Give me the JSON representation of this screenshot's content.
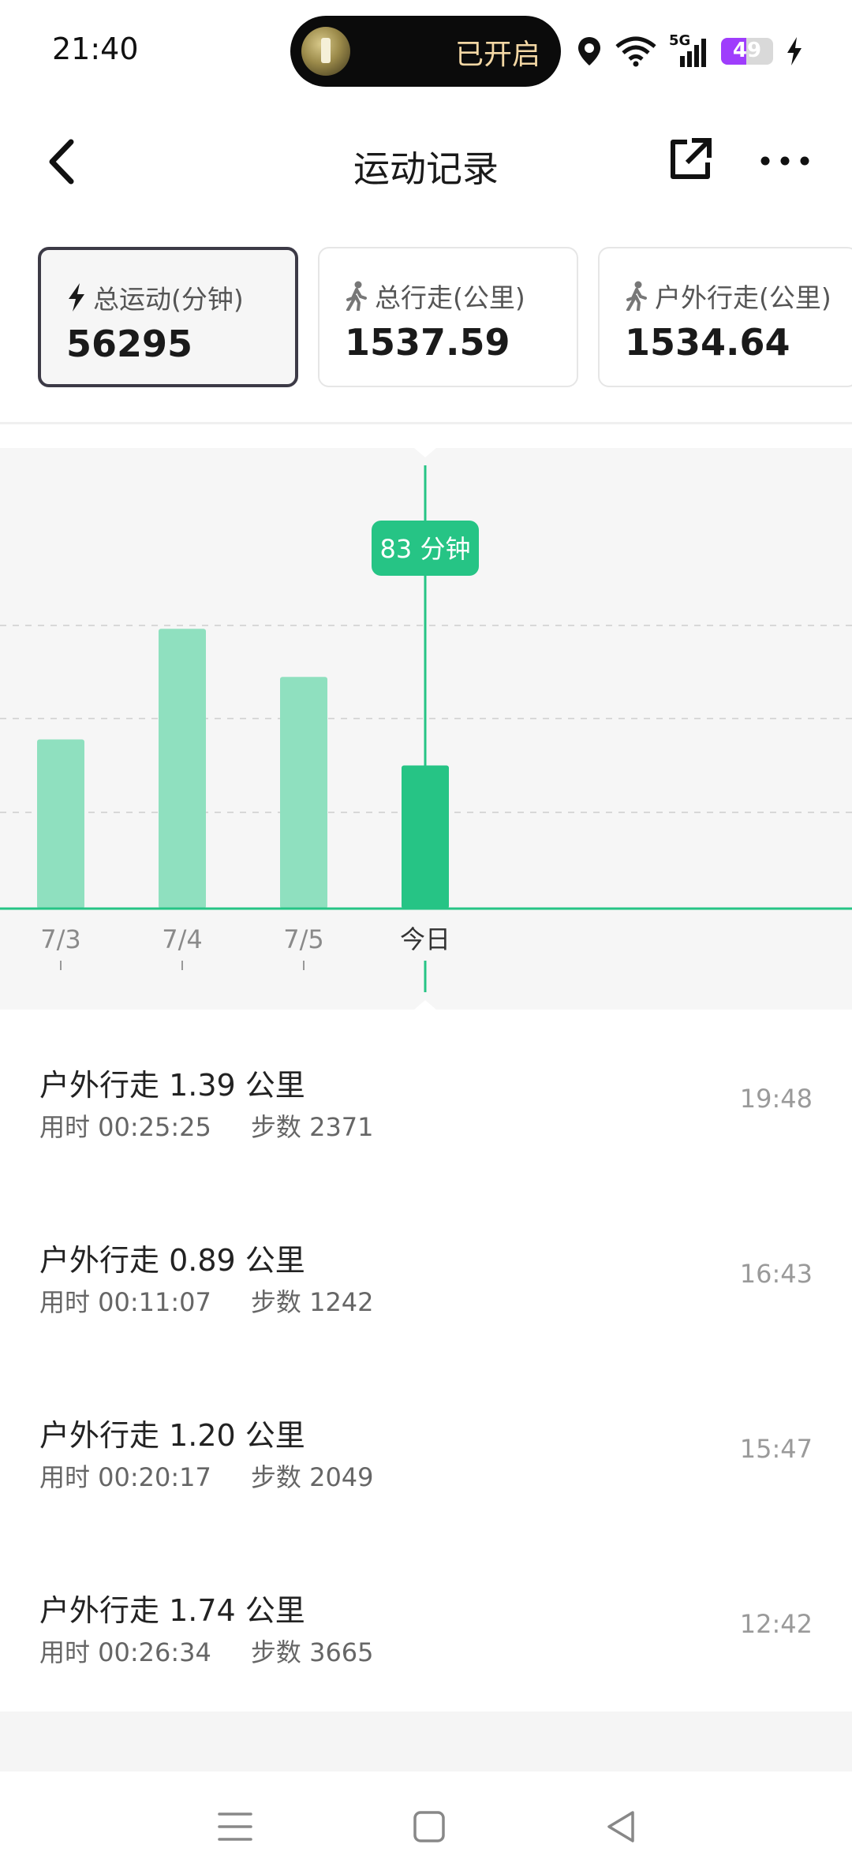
{
  "status_bar": {
    "time": "21:40",
    "pill_text": "已开启",
    "network": "5G",
    "battery_level": "49"
  },
  "header": {
    "title": "运动记录"
  },
  "stats": [
    {
      "label": "总运动(分钟)",
      "value": "56295",
      "icon": "lightning-icon",
      "active": true
    },
    {
      "label": "总行走(公里)",
      "value": "1537.59",
      "icon": "walking-person-icon",
      "active": false
    },
    {
      "label": "户外行走(公里)",
      "value": "1534.64",
      "icon": "walking-person-icon",
      "active": false
    }
  ],
  "chart_data": {
    "type": "bar",
    "categories": [
      "7/3",
      "7/4",
      "7/5",
      "今日"
    ],
    "values": [
      130,
      215,
      178,
      110
    ],
    "highlighted_index": 3,
    "highlight_label": "83 分钟",
    "colors": {
      "bar": "#8fe0bf",
      "bar_active": "#26c485",
      "tooltip": "#26c485"
    },
    "gridlines": true
  },
  "records": [
    {
      "title": "户外行走 1.39 公里",
      "duration": "用时 00:25:25",
      "steps": "步数 2371",
      "time": "19:48"
    },
    {
      "title": "户外行走 0.89 公里",
      "duration": "用时 00:11:07",
      "steps": "步数 1242",
      "time": "16:43"
    },
    {
      "title": "户外行走 1.20 公里",
      "duration": "用时 00:20:17",
      "steps": "步数 2049",
      "time": "15:47"
    },
    {
      "title": "户外行走 1.74 公里",
      "duration": "用时 00:26:34",
      "steps": "步数 3665",
      "time": "12:42"
    }
  ]
}
